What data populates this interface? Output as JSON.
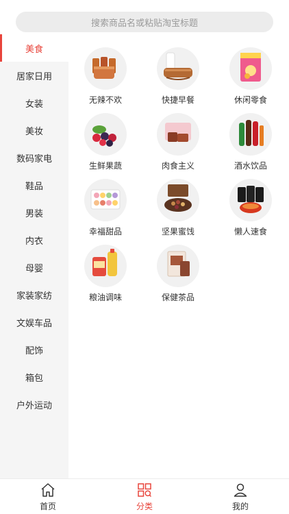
{
  "search": {
    "placeholder": "搜索商品名或粘贴淘宝标题"
  },
  "sidebar": {
    "items": [
      {
        "label": "美食",
        "active": true
      },
      {
        "label": "居家日用"
      },
      {
        "label": "女装"
      },
      {
        "label": "美妆"
      },
      {
        "label": "数码家电"
      },
      {
        "label": "鞋品"
      },
      {
        "label": "男装"
      },
      {
        "label": "内衣"
      },
      {
        "label": "母婴"
      },
      {
        "label": "家装家纺"
      },
      {
        "label": "文娱车品"
      },
      {
        "label": "配饰"
      },
      {
        "label": "箱包"
      },
      {
        "label": "户外运动"
      }
    ]
  },
  "categories": [
    {
      "label": "无辣不欢",
      "icon": "spicy-meat-icon"
    },
    {
      "label": "快捷早餐",
      "icon": "bread-milk-icon"
    },
    {
      "label": "休闲零食",
      "icon": "chips-bag-icon"
    },
    {
      "label": "生鲜果蔬",
      "icon": "berries-icon"
    },
    {
      "label": "肉食主义",
      "icon": "meat-box-icon"
    },
    {
      "label": "酒水饮品",
      "icon": "bottles-icon"
    },
    {
      "label": "幸福甜品",
      "icon": "macaron-box-icon"
    },
    {
      "label": "坚果蜜饯",
      "icon": "nuts-tray-icon"
    },
    {
      "label": "懒人速食",
      "icon": "instant-noodles-icon"
    },
    {
      "label": "粮油调味",
      "icon": "rice-oil-icon"
    },
    {
      "label": "保健茶品",
      "icon": "tea-box-icon"
    }
  ],
  "tabbar": {
    "tabs": [
      {
        "label": "首页",
        "icon": "home-icon"
      },
      {
        "label": "分类",
        "icon": "category-grid-icon",
        "active": true
      },
      {
        "label": "我的",
        "icon": "user-icon"
      }
    ]
  },
  "colors": {
    "accent": "#e8453c",
    "sidebar_bg": "#f5f5f5",
    "search_bg": "#ececec"
  }
}
